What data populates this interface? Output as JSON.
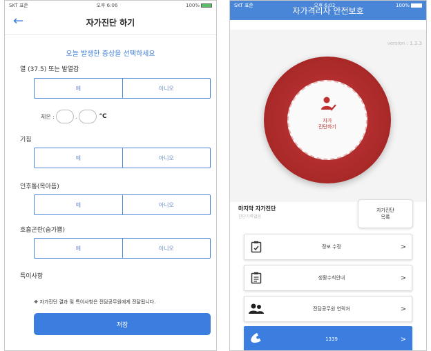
{
  "left": {
    "status": {
      "carrier": "SKT 표준",
      "time": "오후 6:06",
      "battery": "100%"
    },
    "header": {
      "title": "자가진단 하기"
    },
    "subtitle": "오늘 발생한 증상을 선택하세요",
    "questions": [
      {
        "label": "열 (37.5) 또는 발열감",
        "yes": "예",
        "no": "아니오"
      },
      {
        "label": "기침",
        "yes": "예",
        "no": "아니오"
      },
      {
        "label": "인후통(목아픔)",
        "yes": "예",
        "no": "아니오"
      },
      {
        "label": "호흡곤란(숨가쁨)",
        "yes": "예",
        "no": "아니오"
      }
    ],
    "temperature": {
      "label": "체온 :",
      "separator": ".",
      "unit": "°C"
    },
    "remarks_label": "특이사항",
    "notice": "❖ 자가진단 결과 및 특이사항은 전담공무원에게 전달됩니다.",
    "save_label": "저장"
  },
  "right": {
    "status": {
      "carrier": "SKT 표준",
      "time": "오후 6:02",
      "battery": "100%"
    },
    "header": {
      "title": "자가격리자 안전보호"
    },
    "version": "version : 1.3.3",
    "self_check": {
      "line1": "자가",
      "line2": "진단하기"
    },
    "last_check": {
      "title": "마지막 자가진단",
      "subtitle": "진단기록없음"
    },
    "list_button": {
      "line1": "자가진단",
      "line2": "목록"
    },
    "menu": [
      {
        "label": "정보 수정",
        "icon": "clipboard-edit-icon"
      },
      {
        "label": "생활수칙안내",
        "icon": "clipboard-icon"
      },
      {
        "label": "전담공무원 연락처",
        "icon": "people-icon"
      },
      {
        "label": "1339",
        "icon": "phone-icon"
      }
    ],
    "chevron": ">"
  },
  "colors": {
    "accent_blue": "#3b7ee0",
    "header_blue": "#4a86d8",
    "ring_red": "#a82828",
    "icon_red": "#c03030"
  }
}
